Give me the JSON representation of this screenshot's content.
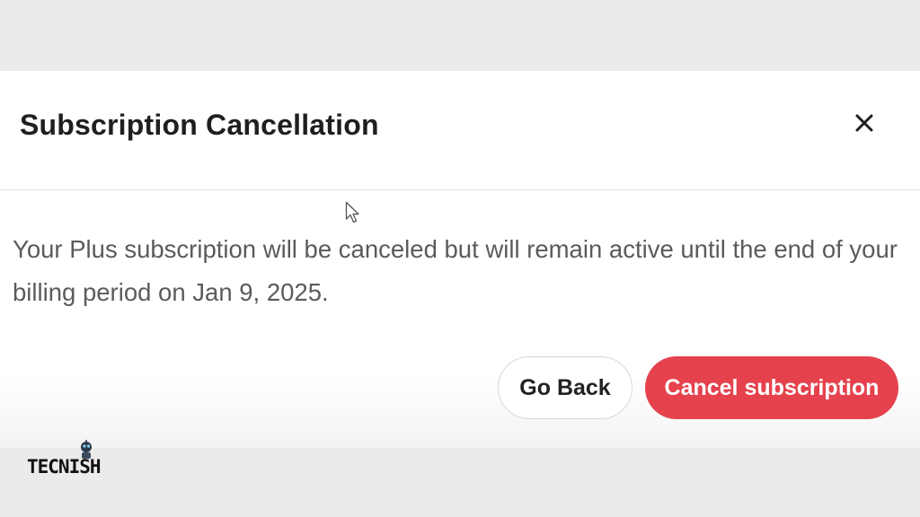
{
  "dialog": {
    "title": "Subscription Cancellation",
    "close_icon": "close-icon",
    "message": "Your Plus subscription will be canceled but will remain active until the end of your billing period on Jan 9, 2025.",
    "buttons": {
      "go_back_label": "Go Back",
      "cancel_label": "Cancel subscription"
    }
  },
  "colors": {
    "page_background": "#ebebeb",
    "dialog_background": "#ffffff",
    "cancel_button": "#e5424d",
    "message_text": "#5b5b5b"
  },
  "cursor_icon": "mouse-pointer-icon",
  "watermark": {
    "text": "TECNISH"
  }
}
